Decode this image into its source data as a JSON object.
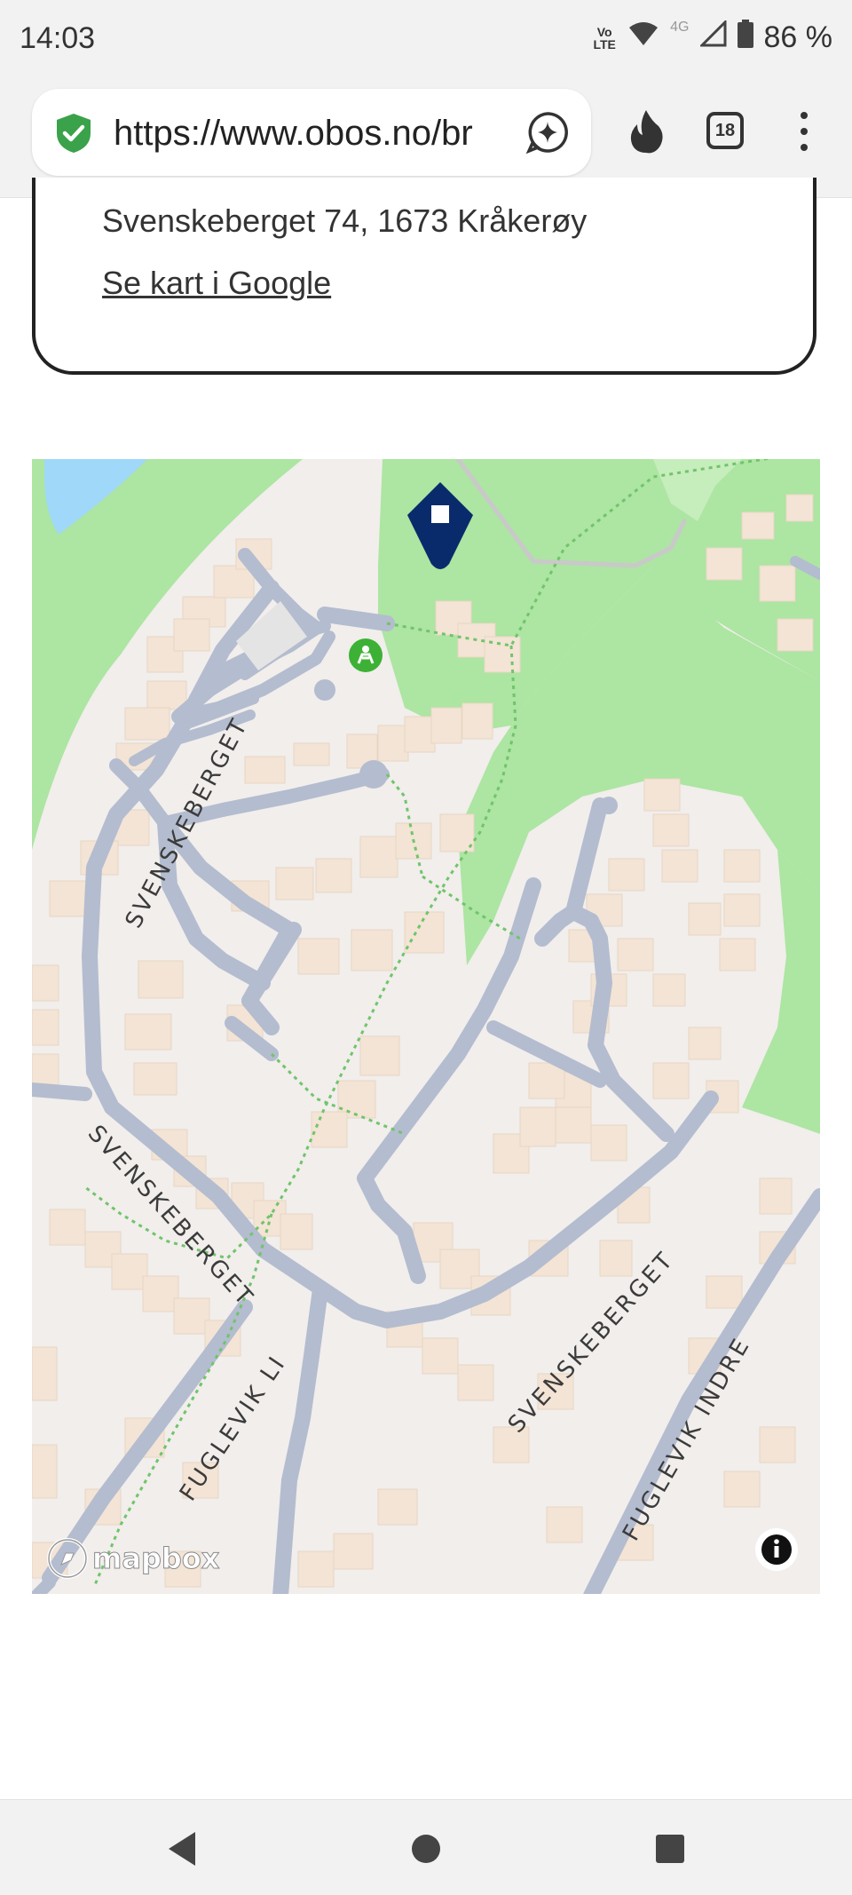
{
  "status_bar": {
    "time": "14:03",
    "network_badge": "Vo LTE",
    "mobile_network": "4G",
    "battery": "86 %"
  },
  "browser": {
    "url": "https://www.obos.no/br",
    "tab_count": "18"
  },
  "address_card": {
    "address": "Svenskeberget 74, 1673 Kråkerøy",
    "map_link": "Se kart i Google"
  },
  "map": {
    "attribution": "mapbox",
    "street_labels": {
      "svenskeberget_1": "SVENSKEBERGET",
      "svenskeberget_2": "SVENSKEBERGET",
      "svenskeberget_3": "SVENSKEBERGET",
      "fuglevik_li": "FUGLEVIK LI",
      "fuglevik_indre": "FUGLEVIK INDRE"
    },
    "colors": {
      "land": "#f1eeec",
      "park": "#ade5a2",
      "water": "#9fd8f9",
      "road": "#b4bccf",
      "building": "#f3e4d5",
      "marker": "#0a2b6b",
      "poi": "#3db135"
    }
  }
}
